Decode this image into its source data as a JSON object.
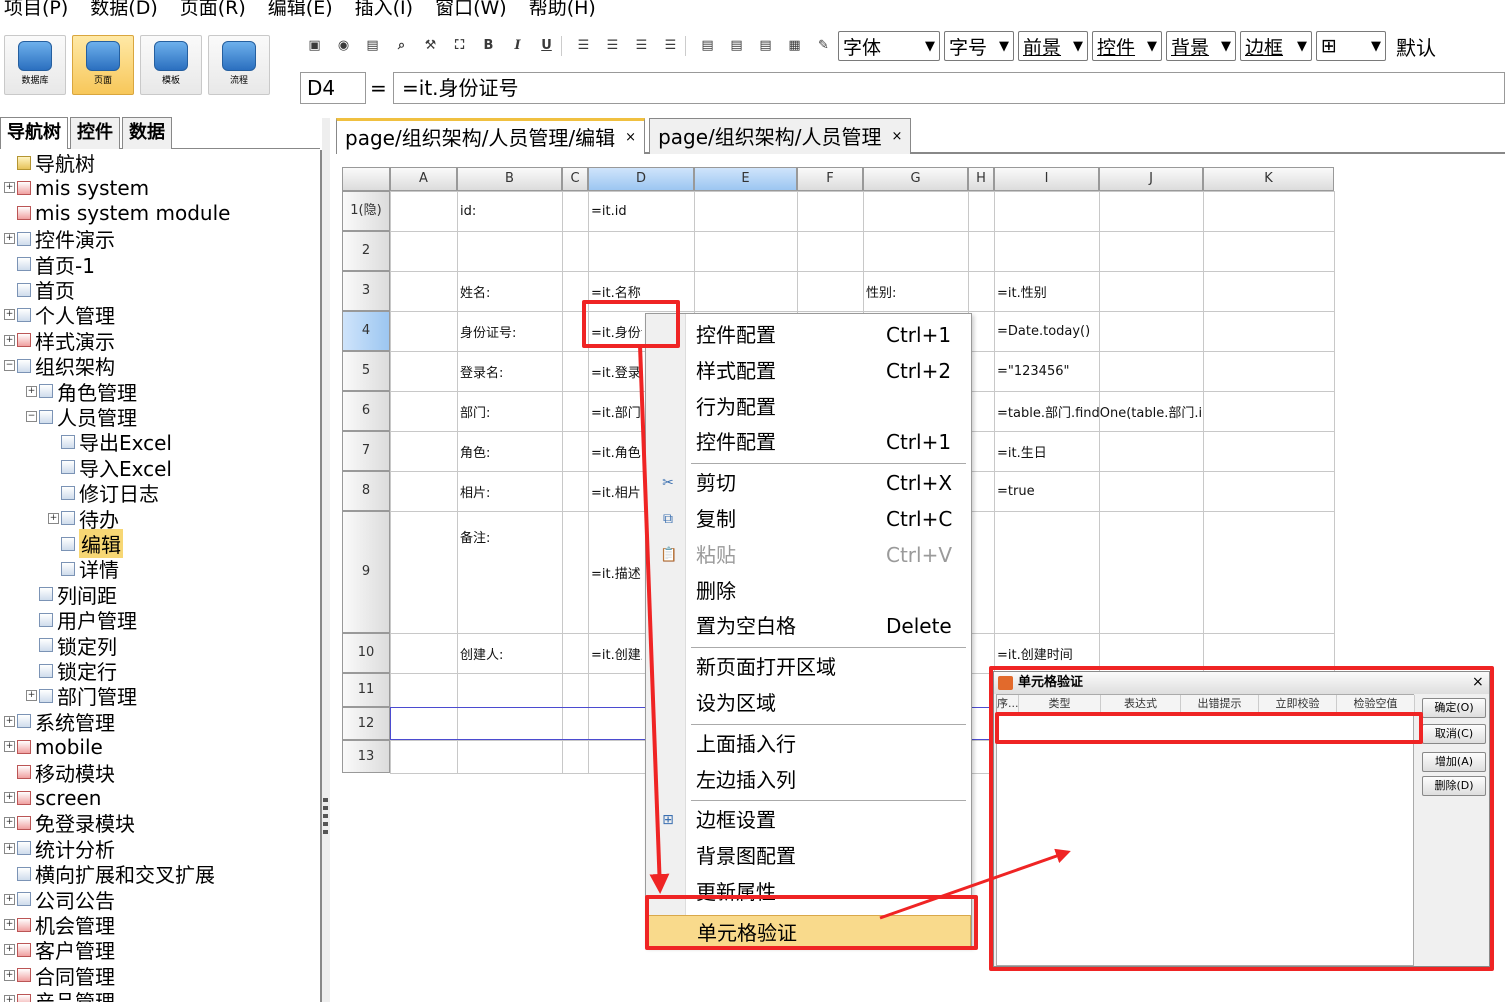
{
  "menubar": [
    "项目(P)",
    "数据(D)",
    "页面(R)",
    "编辑(E)",
    "插入(I)",
    "窗口(W)",
    "帮助(H)"
  ],
  "ribbon": [
    {
      "label": "数据库",
      "icon": "database-icon"
    },
    {
      "label": "页面",
      "icon": "page-icon"
    },
    {
      "label": "模板",
      "icon": "template-icon"
    },
    {
      "label": "流程",
      "icon": "flow-icon"
    }
  ],
  "toolbar": {
    "bold": "B",
    "italic": "I",
    "underline": "U",
    "font": "字体",
    "fontsize": "字号",
    "foreground": "前景",
    "control": "控件",
    "background": "背景",
    "border": "边框",
    "default": "默认"
  },
  "formula": {
    "cellref": "D4",
    "eq": "=",
    "value": "=it.身份证号"
  },
  "lefttabs": [
    "导航树",
    "控件",
    "数据"
  ],
  "tree": [
    {
      "label": "导航树",
      "level": 0,
      "expander": "",
      "icon": "folder"
    },
    {
      "label": "mis system",
      "level": 0,
      "expander": "+",
      "icon": "red"
    },
    {
      "label": "mis system module",
      "level": 0,
      "expander": "",
      "icon": "red"
    },
    {
      "label": "控件演示",
      "level": 0,
      "expander": "+",
      "icon": "blue"
    },
    {
      "label": "首页-1",
      "level": 0,
      "expander": "",
      "icon": "blue"
    },
    {
      "label": "首页",
      "level": 0,
      "expander": "",
      "icon": "page"
    },
    {
      "label": "个人管理",
      "level": 0,
      "expander": "+",
      "icon": "blue"
    },
    {
      "label": "样式演示",
      "level": 0,
      "expander": "+",
      "icon": "red"
    },
    {
      "label": "组织架构",
      "level": 0,
      "expander": "-",
      "icon": "blue"
    },
    {
      "label": "角色管理",
      "level": 1,
      "expander": "+",
      "icon": "page"
    },
    {
      "label": "人员管理",
      "level": 1,
      "expander": "-",
      "icon": "page"
    },
    {
      "label": "导出Excel",
      "level": 2,
      "expander": "",
      "icon": "blue"
    },
    {
      "label": "导入Excel",
      "level": 2,
      "expander": "",
      "icon": "page"
    },
    {
      "label": "修订日志",
      "level": 2,
      "expander": "",
      "icon": "page"
    },
    {
      "label": "待办",
      "level": 2,
      "expander": "+",
      "icon": "page"
    },
    {
      "label": "编辑",
      "level": 2,
      "expander": "",
      "icon": "page",
      "selected": true
    },
    {
      "label": "详情",
      "level": 2,
      "expander": "",
      "icon": "page"
    },
    {
      "label": "列间距",
      "level": 1,
      "expander": "",
      "icon": "page"
    },
    {
      "label": "用户管理",
      "level": 1,
      "expander": "",
      "icon": "page"
    },
    {
      "label": "锁定列",
      "level": 1,
      "expander": "",
      "icon": "page"
    },
    {
      "label": "锁定行",
      "level": 1,
      "expander": "",
      "icon": "page"
    },
    {
      "label": "部门管理",
      "level": 1,
      "expander": "+",
      "icon": "page"
    },
    {
      "label": "系统管理",
      "level": 0,
      "expander": "+",
      "icon": "blue"
    },
    {
      "label": "mobile",
      "level": 0,
      "expander": "+",
      "icon": "red"
    },
    {
      "label": "移动模块",
      "level": 0,
      "expander": "",
      "icon": "red"
    },
    {
      "label": "screen",
      "level": 0,
      "expander": "+",
      "icon": "red"
    },
    {
      "label": "免登录模块",
      "level": 0,
      "expander": "+",
      "icon": "red"
    },
    {
      "label": "统计分析",
      "level": 0,
      "expander": "+",
      "icon": "blue"
    },
    {
      "label": "横向扩展和交叉扩展",
      "level": 0,
      "expander": "",
      "icon": "blue"
    },
    {
      "label": "公司公告",
      "level": 0,
      "expander": "+",
      "icon": "blue"
    },
    {
      "label": "机会管理",
      "level": 0,
      "expander": "+",
      "icon": "red"
    },
    {
      "label": "客户管理",
      "level": 0,
      "expander": "+",
      "icon": "red"
    },
    {
      "label": "合同管理",
      "level": 0,
      "expander": "+",
      "icon": "red"
    },
    {
      "label": "产品管理",
      "level": 0,
      "expander": "+",
      "icon": "red"
    }
  ],
  "pagetabs": [
    {
      "label": "page/组织架构/人员管理/编辑",
      "close": "×",
      "active": true
    },
    {
      "label": "page/组织架构/人员管理",
      "close": "×",
      "active": false
    }
  ],
  "grid": {
    "columns": [
      "A",
      "B",
      "C",
      "D",
      "E",
      "F",
      "G",
      "H",
      "I",
      "J",
      "K"
    ],
    "rows": [
      "1(隐)",
      "2",
      "3",
      "4",
      "5",
      "6",
      "7",
      "8",
      "9",
      "10",
      "11",
      "12",
      "13"
    ],
    "cells": [
      {
        "r": 0,
        "c": "B",
        "text": "id:"
      },
      {
        "r": 0,
        "c": "D",
        "text": "=it.id"
      },
      {
        "r": 2,
        "c": "B",
        "text": "姓名:"
      },
      {
        "r": 2,
        "c": "D",
        "text": "=it.名称"
      },
      {
        "r": 2,
        "c": "G",
        "text": "性别:"
      },
      {
        "r": 2,
        "c": "I",
        "text": "=it.性别"
      },
      {
        "r": 3,
        "c": "B",
        "text": "身份证号:"
      },
      {
        "r": 3,
        "c": "D",
        "text": "=it.身份证号"
      },
      {
        "r": 3,
        "c": "I",
        "text": "=Date.today()"
      },
      {
        "r": 4,
        "c": "B",
        "text": "登录名:"
      },
      {
        "r": 4,
        "c": "D",
        "text": "=it.登录名"
      },
      {
        "r": 4,
        "c": "I",
        "text": "=\"123456\""
      },
      {
        "r": 5,
        "c": "B",
        "text": "部门:"
      },
      {
        "r": 5,
        "c": "D",
        "text": "=it.部门"
      },
      {
        "r": 5,
        "c": "I",
        "text": "=table.部门.findOne(table.部门.i"
      },
      {
        "r": 6,
        "c": "B",
        "text": "角色:"
      },
      {
        "r": 6,
        "c": "D",
        "text": "=it.角色"
      },
      {
        "r": 6,
        "c": "I",
        "text": "=it.生日"
      },
      {
        "r": 7,
        "c": "B",
        "text": "相片:"
      },
      {
        "r": 7,
        "c": "D",
        "text": "=it.相片"
      },
      {
        "r": 7,
        "c": "I",
        "text": "=true"
      },
      {
        "r": 8,
        "c": "B",
        "text": "备注:"
      },
      {
        "r": 8,
        "c": "D",
        "text": "=it.描述"
      },
      {
        "r": 9,
        "c": "B",
        "text": "创建人:"
      },
      {
        "r": 9,
        "c": "D",
        "text": "=it.创建人"
      },
      {
        "r": 9,
        "c": "I",
        "text": "=it.创建时间"
      }
    ]
  },
  "contextmenu": [
    {
      "label": "控件配置",
      "shortcut": "Ctrl+1"
    },
    {
      "label": "样式配置",
      "shortcut": "Ctrl+2"
    },
    {
      "label": "行为配置",
      "shortcut": ""
    },
    {
      "label": "控件配置",
      "shortcut": "Ctrl+1"
    },
    {
      "sep": true
    },
    {
      "label": "剪切",
      "shortcut": "Ctrl+X",
      "icon": "✂"
    },
    {
      "label": "复制",
      "shortcut": "Ctrl+C",
      "icon": "⧉"
    },
    {
      "label": "粘贴",
      "shortcut": "Ctrl+V",
      "icon": "📋",
      "disabled": true
    },
    {
      "label": "删除",
      "shortcut": ""
    },
    {
      "label": "置为空白格",
      "shortcut": "Delete"
    },
    {
      "sep": true
    },
    {
      "label": "新页面打开区域",
      "shortcut": ""
    },
    {
      "label": "设为区域",
      "shortcut": ""
    },
    {
      "sep": true
    },
    {
      "label": "上面插入行",
      "shortcut": ""
    },
    {
      "label": "左边插入列",
      "shortcut": ""
    },
    {
      "sep": true
    },
    {
      "label": "边框设置",
      "shortcut": "",
      "icon": "⊞"
    },
    {
      "label": "背景图配置",
      "shortcut": ""
    },
    {
      "label": "更新属性",
      "shortcut": ""
    },
    {
      "label": "单元格验证",
      "shortcut": "",
      "highlight": true
    }
  ],
  "dialog": {
    "title": "单元格验证",
    "close": "×",
    "columns": [
      "序...",
      "类型",
      "表达式",
      "出错提示",
      "立即校验",
      "检验空值"
    ],
    "buttons": [
      "确定(O)",
      "取消(C)",
      "增加(A)",
      "删除(D)"
    ]
  }
}
